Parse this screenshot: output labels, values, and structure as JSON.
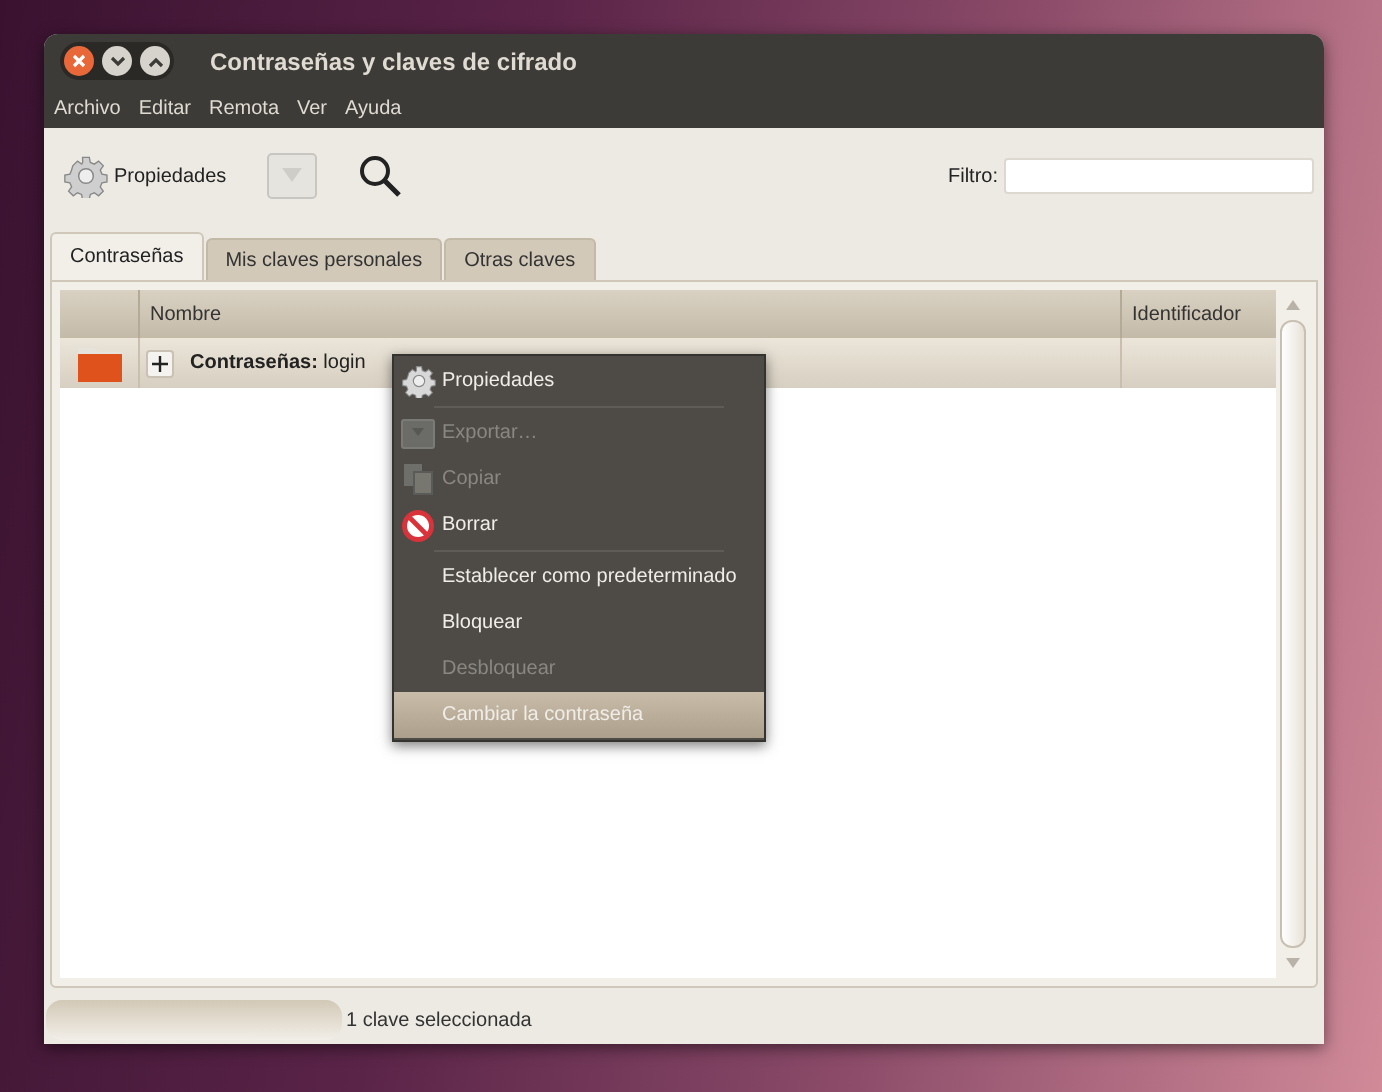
{
  "window": {
    "title": "Contraseñas y claves de cifrado"
  },
  "menu_bar": [
    "Archivo",
    "Editar",
    "Remota",
    "Ver",
    "Ayuda"
  ],
  "toolbar": {
    "properties_button": "Propiedades",
    "filter_label": "Filtro:"
  },
  "tabs": [
    {
      "label": "Contraseñas",
      "selected": true
    },
    {
      "label": "Mis claves personales",
      "selected": false
    },
    {
      "label": "Otras claves",
      "selected": false
    }
  ],
  "table": {
    "columns": [
      "Nombre",
      "Identificador"
    ],
    "rows": [
      {
        "name": "**Contraseñas:** login",
        "selected": true
      }
    ]
  },
  "context_menu": [
    {
      "kind": "item",
      "label": "Propiedades",
      "disabled": false,
      "selected": false
    },
    {
      "kind": "separator"
    },
    {
      "kind": "item",
      "label": "Exportar…",
      "disabled": true,
      "selected": false
    },
    {
      "kind": "item",
      "label": "Copiar",
      "disabled": true,
      "selected": false
    },
    {
      "kind": "item",
      "label": "Borrar",
      "disabled": false,
      "selected": false
    },
    {
      "kind": "separator"
    },
    {
      "kind": "item",
      "label": "Establecer como predeterminado",
      "disabled": false,
      "selected": false
    },
    {
      "kind": "item",
      "label": "Bloquear",
      "disabled": false,
      "selected": false
    },
    {
      "kind": "item",
      "label": "Desbloquear",
      "disabled": true,
      "selected": false
    },
    {
      "kind": "item",
      "label": "Cambiar la contraseña",
      "disabled": false,
      "selected": true
    }
  ],
  "status_bar": {
    "progress": {
      "level": 0
    },
    "text": "1 clave seleccionada"
  }
}
